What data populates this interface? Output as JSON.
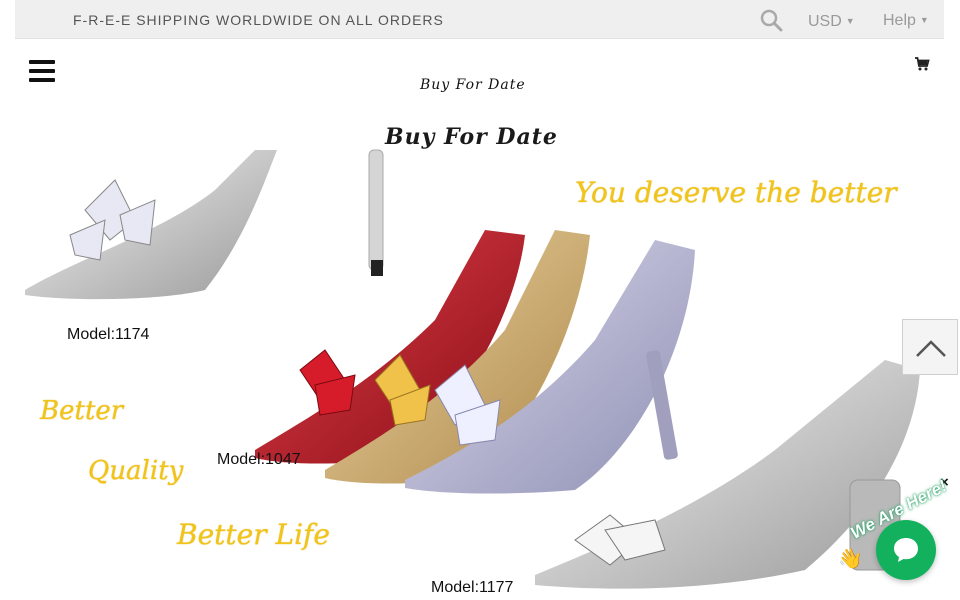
{
  "topbar": {
    "promo_text": "F-R-E-E SHIPPING WORLDWIDE ON ALL ORDERS",
    "currency": "USD",
    "help_label": "Help",
    "search_icon": "search-icon",
    "caret_icon": "caret-down-icon"
  },
  "header": {
    "menu_icon": "hamburger-menu-icon",
    "logo_text": "Buy For Date",
    "cart_icon": "shopping-cart-icon"
  },
  "banner": {
    "title": "Buy For Date",
    "slogans": [
      "You deserve the better",
      "Better",
      "Quality",
      "Better   Life"
    ],
    "models": [
      "Model:1174",
      "Model:1047",
      "Model:1177"
    ]
  },
  "widgets": {
    "back_to_top_icon": "chevron-up-icon",
    "close_glyph": "×",
    "chat_label": "We Are Here!",
    "wave_emoji": "👋",
    "chat_icon": "chat-bubble-icon"
  },
  "colors": {
    "slogan_yellow": "#f0c419",
    "chat_green": "#13b15d",
    "topbar_bg": "#efefef"
  }
}
